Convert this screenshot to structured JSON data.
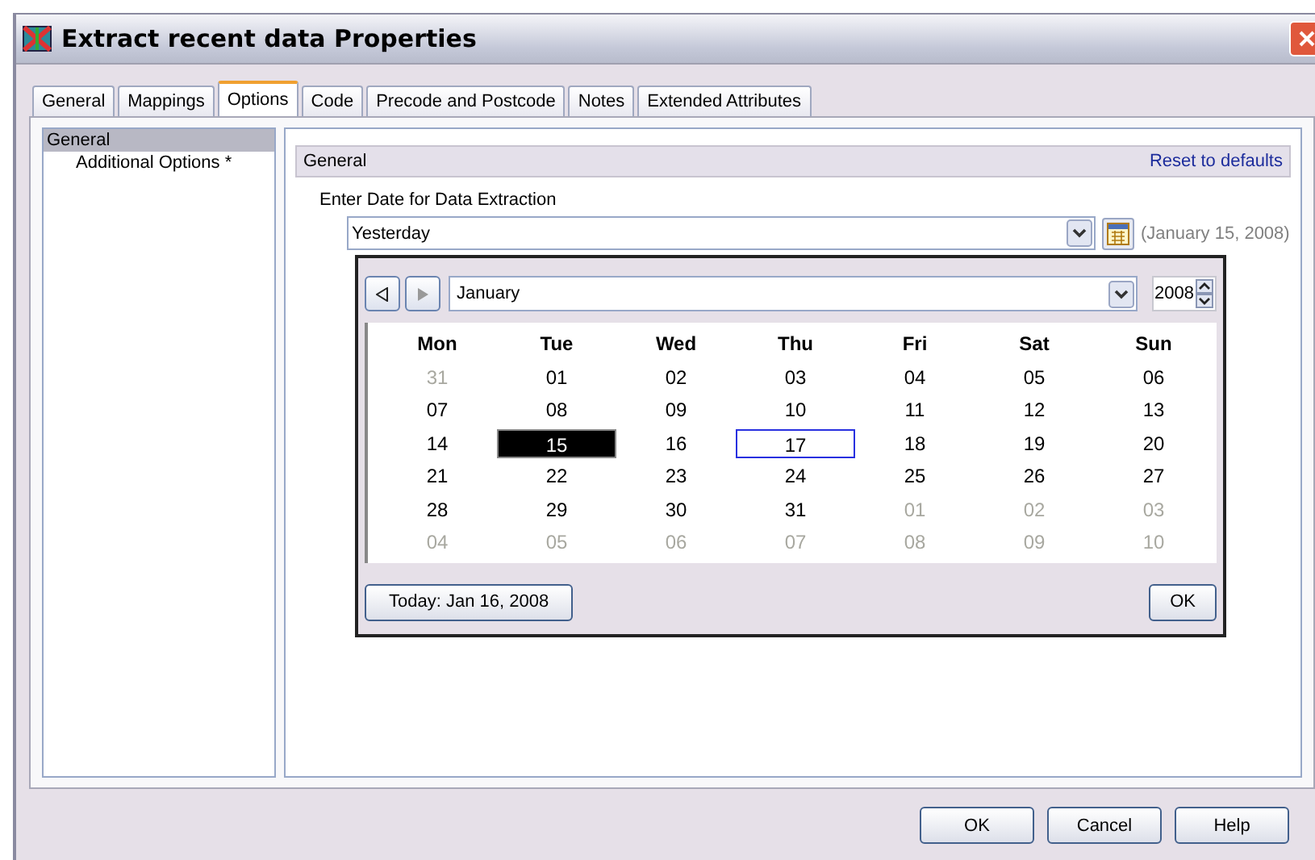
{
  "window": {
    "title": "Extract recent data Properties"
  },
  "tabs": [
    {
      "label": "General",
      "selected": false
    },
    {
      "label": "Mappings",
      "selected": false
    },
    {
      "label": "Options",
      "selected": true
    },
    {
      "label": "Code",
      "selected": false
    },
    {
      "label": "Precode and Postcode",
      "selected": false
    },
    {
      "label": "Notes",
      "selected": false
    },
    {
      "label": "Extended Attributes",
      "selected": false
    }
  ],
  "tree": [
    {
      "label": "General",
      "selected": true,
      "children": [
        {
          "label": "Additional Options *",
          "selected": false
        }
      ]
    }
  ],
  "panel": {
    "title": "General",
    "reset_link": "Reset to defaults",
    "field_label": "Enter Date for Data Extraction",
    "date_value": "Yesterday",
    "date_hint": "(January 15, 2008)"
  },
  "calendar": {
    "month": "January",
    "year": "2008",
    "weekdays": [
      "Mon",
      "Tue",
      "Wed",
      "Thu",
      "Fri",
      "Sat",
      "Sun"
    ],
    "weeks": [
      [
        {
          "d": "31",
          "muted": true,
          "selected": false,
          "focused": false
        },
        {
          "d": "01",
          "muted": false,
          "selected": false,
          "focused": false
        },
        {
          "d": "02",
          "muted": false,
          "selected": false,
          "focused": false
        },
        {
          "d": "03",
          "muted": false,
          "selected": false,
          "focused": false
        },
        {
          "d": "04",
          "muted": false,
          "selected": false,
          "focused": false
        },
        {
          "d": "05",
          "muted": false,
          "selected": false,
          "focused": false
        },
        {
          "d": "06",
          "muted": false,
          "selected": false,
          "focused": false
        }
      ],
      [
        {
          "d": "07",
          "muted": false,
          "selected": false,
          "focused": false
        },
        {
          "d": "08",
          "muted": false,
          "selected": false,
          "focused": false
        },
        {
          "d": "09",
          "muted": false,
          "selected": false,
          "focused": false
        },
        {
          "d": "10",
          "muted": false,
          "selected": false,
          "focused": false
        },
        {
          "d": "11",
          "muted": false,
          "selected": false,
          "focused": false
        },
        {
          "d": "12",
          "muted": false,
          "selected": false,
          "focused": false
        },
        {
          "d": "13",
          "muted": false,
          "selected": false,
          "focused": false
        }
      ],
      [
        {
          "d": "14",
          "muted": false,
          "selected": false,
          "focused": false
        },
        {
          "d": "15",
          "muted": false,
          "selected": true,
          "focused": false
        },
        {
          "d": "16",
          "muted": false,
          "selected": false,
          "focused": false
        },
        {
          "d": "17",
          "muted": false,
          "selected": false,
          "focused": true
        },
        {
          "d": "18",
          "muted": false,
          "selected": false,
          "focused": false
        },
        {
          "d": "19",
          "muted": false,
          "selected": false,
          "focused": false
        },
        {
          "d": "20",
          "muted": false,
          "selected": false,
          "focused": false
        }
      ],
      [
        {
          "d": "21",
          "muted": false,
          "selected": false,
          "focused": false
        },
        {
          "d": "22",
          "muted": false,
          "selected": false,
          "focused": false
        },
        {
          "d": "23",
          "muted": false,
          "selected": false,
          "focused": false
        },
        {
          "d": "24",
          "muted": false,
          "selected": false,
          "focused": false
        },
        {
          "d": "25",
          "muted": false,
          "selected": false,
          "focused": false
        },
        {
          "d": "26",
          "muted": false,
          "selected": false,
          "focused": false
        },
        {
          "d": "27",
          "muted": false,
          "selected": false,
          "focused": false
        }
      ],
      [
        {
          "d": "28",
          "muted": false,
          "selected": false,
          "focused": false
        },
        {
          "d": "29",
          "muted": false,
          "selected": false,
          "focused": false
        },
        {
          "d": "30",
          "muted": false,
          "selected": false,
          "focused": false
        },
        {
          "d": "31",
          "muted": false,
          "selected": false,
          "focused": false
        },
        {
          "d": "01",
          "muted": true,
          "selected": false,
          "focused": false
        },
        {
          "d": "02",
          "muted": true,
          "selected": false,
          "focused": false
        },
        {
          "d": "03",
          "muted": true,
          "selected": false,
          "focused": false
        }
      ],
      [
        {
          "d": "04",
          "muted": true,
          "selected": false,
          "focused": false
        },
        {
          "d": "05",
          "muted": true,
          "selected": false,
          "focused": false
        },
        {
          "d": "06",
          "muted": true,
          "selected": false,
          "focused": false
        },
        {
          "d": "07",
          "muted": true,
          "selected": false,
          "focused": false
        },
        {
          "d": "08",
          "muted": true,
          "selected": false,
          "focused": false
        },
        {
          "d": "09",
          "muted": true,
          "selected": false,
          "focused": false
        },
        {
          "d": "10",
          "muted": true,
          "selected": false,
          "focused": false
        }
      ]
    ],
    "today_button": "Today: Jan 16, 2008",
    "ok_button": "OK"
  },
  "buttons": [
    "OK",
    "Cancel",
    "Help"
  ]
}
